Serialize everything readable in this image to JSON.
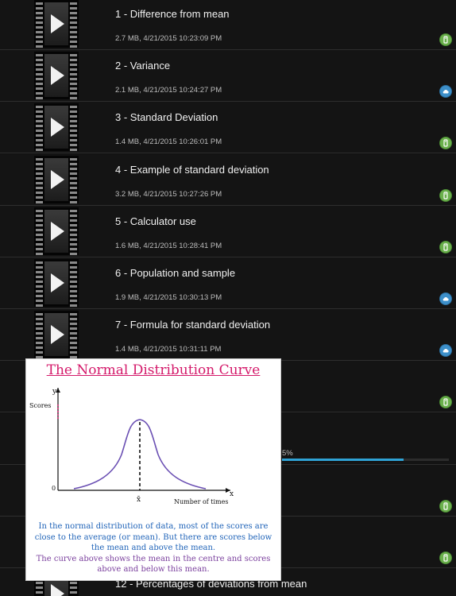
{
  "list": {
    "items": [
      {
        "title": "1 - Difference from mean",
        "meta": "2.7 MB, 4/21/2015 10:23:09 PM",
        "status": "device"
      },
      {
        "title": "2 - Variance",
        "meta": "2.1 MB, 4/21/2015 10:24:27 PM",
        "status": "cloud"
      },
      {
        "title": "3 - Standard Deviation",
        "meta": "1.4 MB, 4/21/2015 10:26:01 PM",
        "status": "device"
      },
      {
        "title": "4 - Example of standard deviation",
        "meta": "3.2 MB, 4/21/2015 10:27:26 PM",
        "status": "device"
      },
      {
        "title": "5 - Calculator use",
        "meta": "1.6 MB, 4/21/2015 10:28:41 PM",
        "status": "device"
      },
      {
        "title": "6 - Population and sample",
        "meta": "1.9 MB, 4/21/2015 10:30:13 PM",
        "status": "cloud"
      },
      {
        "title": "7 - Formula for standard deviation",
        "meta": "1.4 MB, 4/21/2015 10:31:11 PM",
        "status": "cloud"
      },
      {
        "title": "",
        "meta": "",
        "status": "device"
      },
      {
        "title": "",
        "meta": "",
        "status": "none",
        "progress": {
          "text": "5%",
          "fraction": 0.73
        }
      },
      {
        "title": "",
        "meta": "",
        "status": "device"
      },
      {
        "title": "",
        "meta": "",
        "status": "device"
      },
      {
        "title": "12 - Percentages of deviations from mean",
        "meta": "",
        "status": "none"
      }
    ]
  },
  "overlay": {
    "title": "The Normal Distribution Curve",
    "y_axis_letter": "y",
    "y_axis_label": "Scores",
    "origin_label": "0",
    "x_axis_letter": "x",
    "x_axis_label": "Number of times",
    "mean_label": "x̄",
    "text_line1": "In the normal distribution of data, most of the scores are close to the average (or mean).  But there are scores below the mean and above the mean.",
    "text_line2": "The curve above shows the mean in the centre and scores above and below this mean.",
    "colors": {
      "title": "#d4196a",
      "curve": "#6a4fb3",
      "text1": "#1f63b8",
      "text2": "#7a3f9d"
    }
  }
}
